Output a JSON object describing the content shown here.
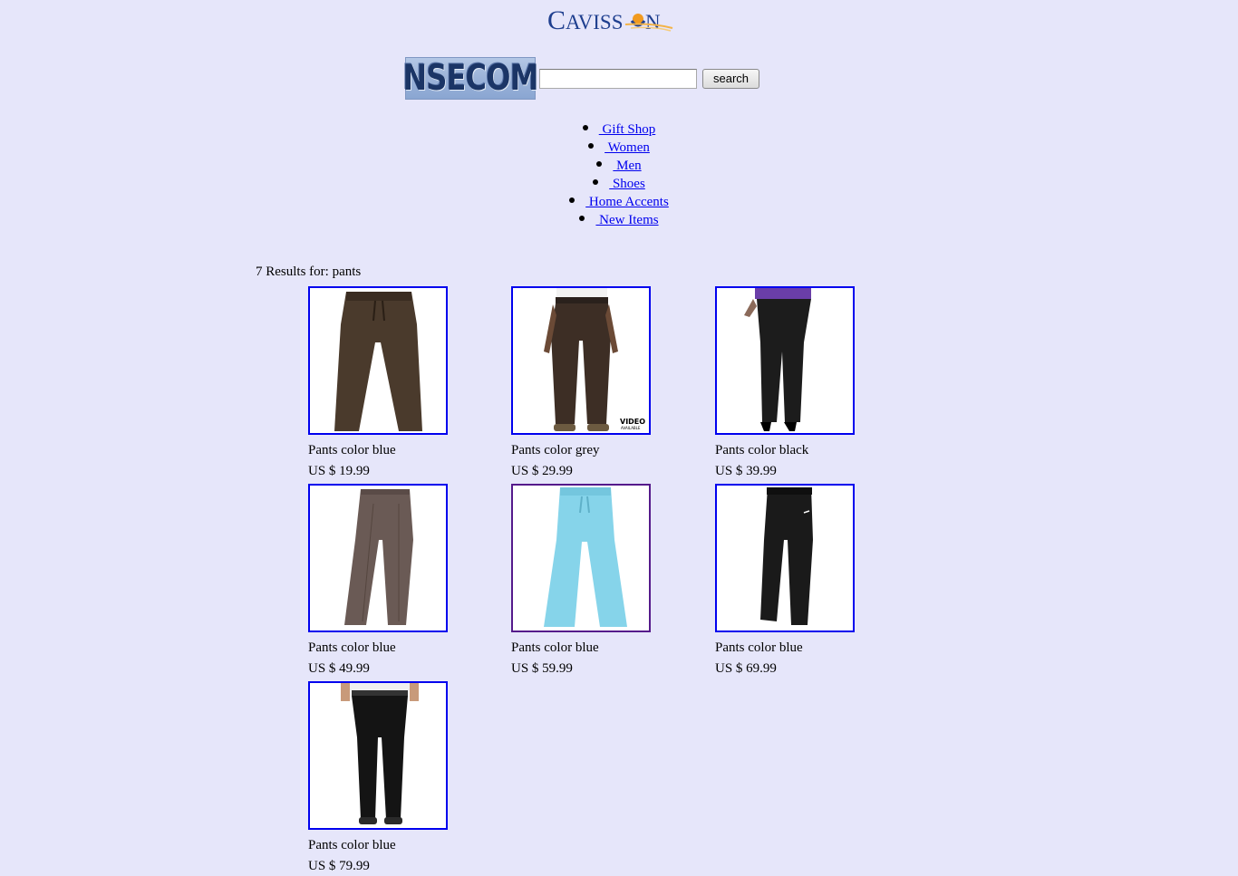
{
  "logo": {
    "brand": "CAVISSON"
  },
  "header": {
    "store_logo": "NSECOM",
    "search": {
      "value": "",
      "placeholder": "",
      "button_label": "search"
    }
  },
  "nav": {
    "items": [
      {
        "label": " Gift Shop "
      },
      {
        "label": " Women "
      },
      {
        "label": " Men "
      },
      {
        "label": " Shoes "
      },
      {
        "label": " Home Accents "
      },
      {
        "label": " New Items "
      }
    ]
  },
  "results": {
    "summary": "7 Results for: pants",
    "products": [
      {
        "name": "Pants color blue",
        "price": "US $ 19.99",
        "image": "pants-brown-sweat",
        "color": "#4a3a2c"
      },
      {
        "name": "Pants color grey",
        "price": "US $ 29.99",
        "image": "pants-brown-jeans",
        "color": "#3d2e25"
      },
      {
        "name": "Pants color black",
        "price": "US $ 39.99",
        "image": "pants-black-women",
        "color": "#1c1c1c"
      },
      {
        "name": "Pants color blue",
        "price": "US $ 49.99",
        "image": "pants-taupe-trouser",
        "color": "#6a5a55"
      },
      {
        "name": "Pants color blue",
        "price": "US $ 59.99",
        "image": "pants-aqua-flare",
        "color": "#86d4ea"
      },
      {
        "name": "Pants color blue",
        "price": "US $ 69.99",
        "image": "pants-black-track",
        "color": "#1a1a1a"
      },
      {
        "name": "Pants color blue",
        "price": "US $ 79.99",
        "image": "pants-black-dress",
        "color": "#141414"
      }
    ]
  },
  "colors": {
    "background": "#e6e6fa",
    "link": "#0000ee",
    "visited": "#551a8b"
  }
}
